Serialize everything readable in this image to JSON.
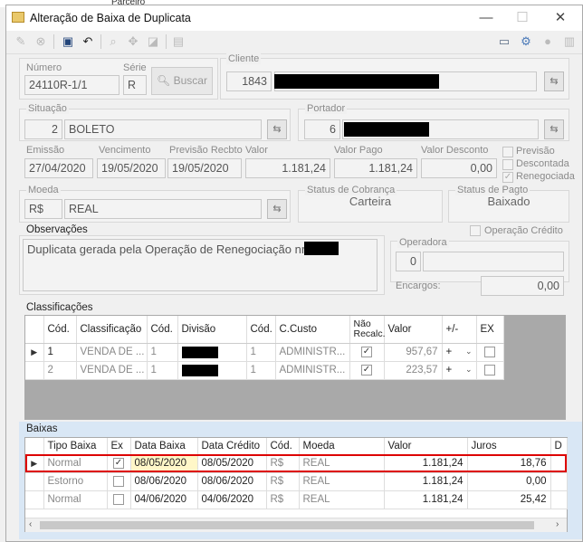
{
  "background": {
    "partial_label": "Parceiro"
  },
  "window": {
    "title": "Alteração de Baixa de Duplicata",
    "controls": {
      "minimize": "—",
      "maximize": "☐",
      "close": "✕"
    }
  },
  "toolbar": {
    "left_icons": [
      "edit-icon",
      "cancel-icon",
      "save-icon",
      "undo-icon",
      "zoom-icon",
      "move-icon",
      "eraser-icon",
      "print-icon"
    ],
    "right_icons": [
      "window-icon",
      "gear-icon",
      "user-icon",
      "printer-icon"
    ]
  },
  "header": {
    "numero_label": "Número",
    "numero": "24110R-1/1",
    "serie_label": "Série",
    "serie": "R",
    "buscar_label": "Buscar",
    "cliente_label": "Cliente",
    "cliente_codigo": "1843"
  },
  "situacao": {
    "label": "Situação",
    "codigo": "2",
    "descricao": "BOLETO"
  },
  "portador": {
    "label": "Portador",
    "codigo": "6"
  },
  "valores": {
    "emissao_label": "Emissão",
    "emissao": "27/04/2020",
    "vencimento_label": "Vencimento",
    "vencimento": "19/05/2020",
    "previsao_label": "Previsão Recbto",
    "previsao": "19/05/2020",
    "valor_label": "Valor",
    "valor": "1.181,24",
    "valor_pago_label": "Valor Pago",
    "valor_pago": "1.181,24",
    "valor_desconto_label": "Valor Desconto",
    "valor_desconto": "0,00"
  },
  "flags": {
    "previsao": "Previsão",
    "descontada": "Descontada",
    "renegociada": "Renegociada",
    "renegociada_checked": "✓"
  },
  "moeda": {
    "label": "Moeda",
    "codigo": "R$",
    "descricao": "REAL"
  },
  "status_cobranca": {
    "label": "Status de Cobrança",
    "valor": "Carteira"
  },
  "status_pagto": {
    "label": "Status de Pagto",
    "valor": "Baixado"
  },
  "observacoes": {
    "label": "Observações",
    "texto": "Duplicata gerada pela Operação de Renegociação nr."
  },
  "operacao": {
    "credito_label": "Operação Crédito",
    "operadora_label": "Operadora",
    "operadora_codigo": "0",
    "encargos_label": "Encargos:",
    "encargos": "0,00"
  },
  "classificacoes": {
    "label": "Classificações",
    "columns": [
      "Cód.",
      "Classificação",
      "Cód.",
      "Divisão",
      "Cód.",
      "C.Custo",
      "Não Recalc.",
      "Valor",
      "+/-",
      "EX"
    ],
    "rows": [
      {
        "cod": "1",
        "classificacao": "VENDA DE ...",
        "cod_div": "1",
        "cod_cc": "1",
        "ccusto": "ADMINISTR...",
        "nao_recalc": "✓",
        "valor": "957,67",
        "sinal": "+",
        "ex": ""
      },
      {
        "cod": "2",
        "classificacao": "VENDA DE ...",
        "cod_div": "1",
        "cod_cc": "1",
        "ccusto": "ADMINISTR...",
        "nao_recalc": "✓",
        "valor": "223,57",
        "sinal": "+",
        "ex": ""
      }
    ]
  },
  "baixas": {
    "label": "Baixas",
    "columns": [
      "Tipo Baixa",
      "Ex",
      "Data Baixa",
      "Data Crédito",
      "Cód.",
      "Moeda",
      "Valor",
      "Juros",
      "D"
    ],
    "rows": [
      {
        "tipo": "Normal",
        "ex": "✓",
        "data_baixa": "08/05/2020",
        "data_credito": "08/05/2020",
        "cod": "R$",
        "moeda": "REAL",
        "valor": "1.181,24",
        "juros": "18,76"
      },
      {
        "tipo": "Estorno",
        "ex": "",
        "data_baixa": "08/06/2020",
        "data_credito": "08/06/2020",
        "cod": "R$",
        "moeda": "REAL",
        "valor": "1.181,24",
        "juros": "0,00"
      },
      {
        "tipo": "Normal",
        "ex": "",
        "data_baixa": "04/06/2020",
        "data_credito": "04/06/2020",
        "cod": "R$",
        "moeda": "REAL",
        "valor": "1.181,24",
        "juros": "25,42"
      }
    ]
  }
}
